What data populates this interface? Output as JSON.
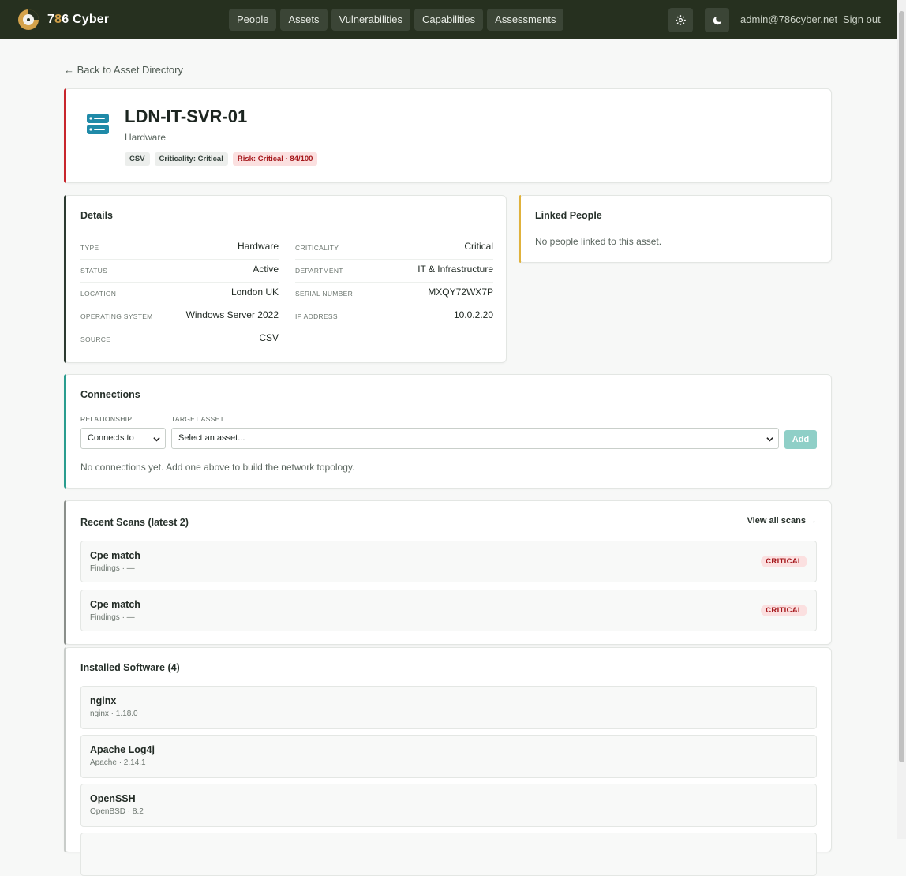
{
  "brand": {
    "name_prefix": "7",
    "name_accent": "8",
    "name_suffix": "6 Cyber"
  },
  "nav": [
    "People",
    "Assets",
    "Vulnerabilities",
    "Capabilities",
    "Assessments"
  ],
  "user": {
    "email": "admin@786cyber.net",
    "signout": "Sign out"
  },
  "back_link": "← Back to Asset Directory",
  "asset": {
    "name": "LDN-IT-SVR-01",
    "type": "Hardware",
    "badges": [
      "CSV",
      "Criticality: Critical",
      "Risk: Critical · 84/100"
    ]
  },
  "details": {
    "title": "Details",
    "rows": [
      {
        "label": "TYPE",
        "value": "Hardware"
      },
      {
        "label": "CRITICALITY",
        "value": "Critical"
      },
      {
        "label": "STATUS",
        "value": "Active"
      },
      {
        "label": "DEPARTMENT",
        "value": "IT & Infrastructure"
      },
      {
        "label": "LOCATION",
        "value": "London UK"
      },
      {
        "label": "SERIAL NUMBER",
        "value": "MXQY72WX7P"
      },
      {
        "label": "OPERATING SYSTEM",
        "value": "Windows Server 2022"
      },
      {
        "label": "IP ADDRESS",
        "value": "10.0.2.20"
      },
      {
        "label": "SOURCE",
        "value": "CSV"
      }
    ]
  },
  "linked_people": {
    "title": "Linked People",
    "empty": "No people linked to this asset."
  },
  "connections": {
    "title": "Connections",
    "relationship_label": "RELATIONSHIP",
    "relationship_value": "Connects to",
    "target_label": "TARGET ASSET",
    "target_placeholder": "Select an asset...",
    "add_label": "Add",
    "empty": "No connections yet. Add one above to build the network topology."
  },
  "scans": {
    "title": "Recent Scans (latest 2)",
    "view_all": "View all scans →",
    "items": [
      {
        "title": "Cpe match",
        "sub": "Findings · —",
        "severity": "CRITICAL"
      },
      {
        "title": "Cpe match",
        "sub": "Findings · —",
        "severity": "CRITICAL"
      }
    ]
  },
  "software": {
    "title": "Installed Software (4)",
    "items": [
      {
        "title": "nginx",
        "sub": "nginx · 1.18.0"
      },
      {
        "title": "Apache Log4j",
        "sub": "Apache · 2.14.1"
      },
      {
        "title": "OpenSSH",
        "sub": "OpenBSD · 8.2"
      }
    ]
  },
  "colors": {
    "topbar": "#26301f",
    "accent_red": "#c8262c",
    "accent_teal": "#2a9d8f",
    "accent_gold": "#e0b23c",
    "asset_icon": "#1f8aa8"
  }
}
